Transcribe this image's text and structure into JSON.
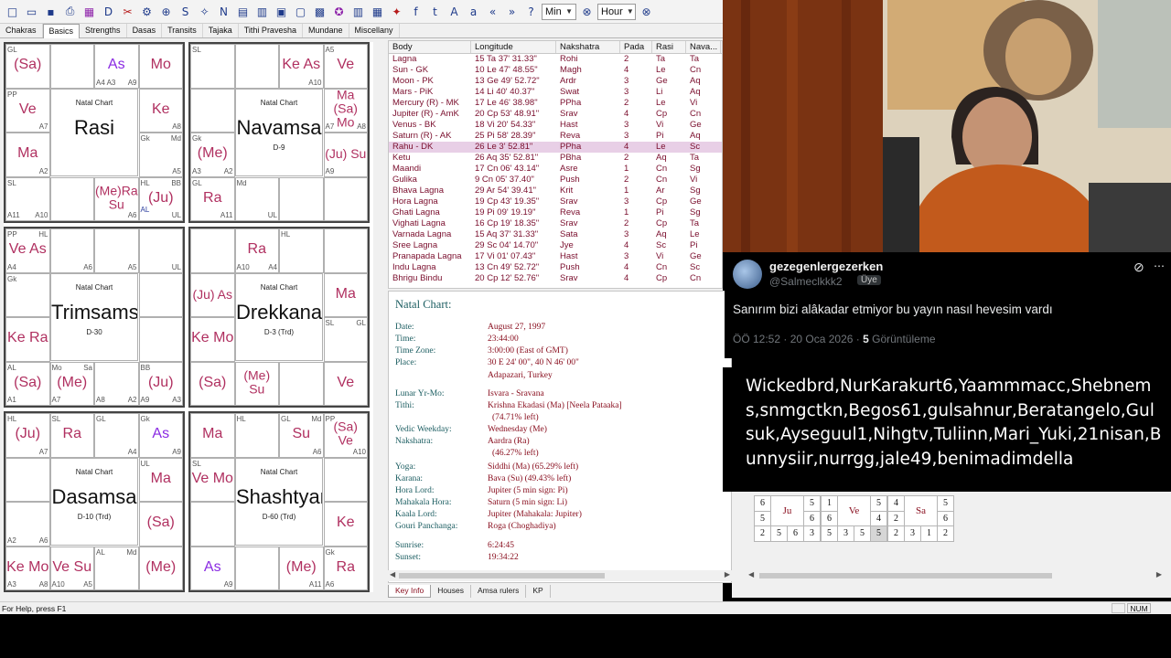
{
  "toolbar": {
    "icons": [
      "new-icon",
      "open-icon",
      "save-icon",
      "print-icon",
      "chart-icon",
      "data-icon",
      "scissors-icon",
      "settings-icon",
      "wheel-icon",
      "sp-kp-icon",
      "bird-icon",
      "n-icon",
      "grid-icon",
      "table-icon",
      "sb-icon",
      "frame-icon",
      "calendar-icon",
      "people-icon",
      "book-icon",
      "gift-icon",
      "bird2-icon",
      "facebook-icon",
      "twitter-icon",
      "text-a-icon",
      "text-a-small-icon",
      "back-icon",
      "forward-icon",
      "help-icon",
      "wheel2-icon"
    ],
    "min_label": "Min",
    "hour_label": "Hour"
  },
  "tabs": [
    "Chakras",
    "Basics",
    "Strengths",
    "Dasas",
    "Transits",
    "Tajaka",
    "Tithi Pravesha",
    "Mundane",
    "Miscellany"
  ],
  "active_tab": "Basics",
  "charts": [
    {
      "title": "Rasi",
      "subtitle": "Natal Chart",
      "note": "",
      "cells": [
        {
          "tl": "GL",
          "tr": "",
          "bl": "",
          "br": "",
          "planets": "(Sa)"
        },
        {
          "tl": "",
          "tr": "",
          "bl": "",
          "br": "",
          "planets": ""
        },
        {
          "tl": "",
          "tr": "",
          "bl": "A4 A3",
          "br": "A9",
          "planets": "As",
          "purple": true
        },
        {
          "tl": "",
          "tr": "",
          "bl": "",
          "br": "",
          "planets": "Mo"
        },
        {
          "tl": "",
          "tr": "",
          "bl": "",
          "br": "A8",
          "planets": "Ke"
        },
        {
          "tl": "Gk",
          "tr": "Md",
          "bl": "",
          "br": "A5",
          "planets": ""
        },
        {
          "tl": "HL",
          "tr": "BB",
          "bl": "",
          "br": "UL",
          "planets": "(Ju)",
          "asc": "AL"
        },
        {
          "tl": "",
          "tr": "",
          "bl": "",
          "br": "A6",
          "planets": "(Me)Ra Su"
        },
        {
          "tl": "",
          "tr": "",
          "bl": "",
          "br": "",
          "planets": ""
        },
        {
          "tl": "SL",
          "tr": "",
          "bl": "A11",
          "br": "A10",
          "planets": ""
        },
        {
          "tl": "",
          "tr": "",
          "bl": "",
          "br": "A2",
          "planets": "Ma"
        },
        {
          "tl": "PP",
          "tr": "",
          "bl": "",
          "br": "A7",
          "planets": "Ve"
        }
      ]
    },
    {
      "title": "Navamsa",
      "subtitle": "Natal Chart",
      "note": "D-9",
      "cells": [
        {
          "tl": "SL",
          "tr": "",
          "bl": "",
          "br": "",
          "planets": ""
        },
        {
          "tl": "",
          "tr": "",
          "bl": "",
          "br": "",
          "planets": ""
        },
        {
          "tl": "",
          "tr": "",
          "bl": "",
          "br": "A10",
          "planets": "Ke As"
        },
        {
          "tl": "A5",
          "tr": "",
          "bl": "",
          "br": "",
          "planets": "Ve"
        },
        {
          "tl": "",
          "tr": "",
          "bl": "A7",
          "br": "A8",
          "planets": "Ma (Sa) Mo"
        },
        {
          "tl": "",
          "tr": "",
          "bl": "A9",
          "br": "",
          "planets": "(Ju) Su"
        },
        {
          "tl": "",
          "tr": "",
          "bl": "",
          "br": "",
          "planets": ""
        },
        {
          "tl": "",
          "tr": "",
          "bl": "",
          "br": "",
          "planets": ""
        },
        {
          "tl": "Md",
          "tr": "",
          "bl": "",
          "br": "UL",
          "planets": ""
        },
        {
          "tl": "GL",
          "tr": "",
          "bl": "",
          "br": "A11",
          "planets": "Ra"
        },
        {
          "tl": "Gk",
          "tr": "",
          "bl": "A3",
          "br": "A2",
          "planets": "(Me)"
        },
        {
          "tl": "",
          "tr": "",
          "bl": "",
          "br": "",
          "planets": ""
        }
      ]
    },
    {
      "title": "Trimsamsa",
      "subtitle": "Natal Chart",
      "note": "D-30",
      "cells": [
        {
          "tl": "PP",
          "tr": "HL",
          "bl": "A4",
          "br": "",
          "planets": "Ve As"
        },
        {
          "tl": "",
          "tr": "",
          "bl": "",
          "br": "A6",
          "planets": ""
        },
        {
          "tl": "",
          "tr": "",
          "bl": "",
          "br": "A5",
          "planets": ""
        },
        {
          "tl": "",
          "tr": "",
          "bl": "",
          "br": "UL",
          "planets": ""
        },
        {
          "tl": "",
          "tr": "",
          "bl": "",
          "br": "",
          "planets": ""
        },
        {
          "tl": "",
          "tr": "",
          "bl": "",
          "br": "",
          "planets": ""
        },
        {
          "tl": "BB",
          "tr": "",
          "bl": "A9",
          "br": "A3",
          "planets": "(Ju)"
        },
        {
          "tl": "",
          "tr": "",
          "bl": "A8",
          "br": "A2",
          "planets": ""
        },
        {
          "tl": "Mo",
          "tr": "Sa",
          "bl": "A7",
          "br": "",
          "planets": "(Me)"
        },
        {
          "tl": "AL",
          "tr": "",
          "bl": "A1",
          "br": "",
          "planets": "(Sa)"
        },
        {
          "tl": "",
          "tr": "",
          "bl": "",
          "br": "",
          "planets": "Ke Ra"
        },
        {
          "tl": "Gk",
          "tr": "",
          "bl": "",
          "br": "",
          "planets": ""
        }
      ]
    },
    {
      "title": "Drekkana",
      "subtitle": "Natal Chart",
      "note": "D-3 (Trd)",
      "cells": [
        {
          "tl": "",
          "tr": "",
          "bl": "",
          "br": "",
          "planets": ""
        },
        {
          "tl": "",
          "tr": "",
          "bl": "A10",
          "br": "A4",
          "planets": "Ra"
        },
        {
          "tl": "HL",
          "tr": "",
          "bl": "",
          "br": "",
          "planets": ""
        },
        {
          "tl": "",
          "tr": "",
          "bl": "",
          "br": "",
          "planets": ""
        },
        {
          "tl": "",
          "tr": "",
          "bl": "",
          "br": "",
          "planets": "Ma"
        },
        {
          "tl": "SL",
          "tr": "GL",
          "bl": "",
          "br": "",
          "planets": ""
        },
        {
          "tl": "",
          "tr": "",
          "bl": "",
          "br": "",
          "planets": "Ve"
        },
        {
          "tl": "",
          "tr": "",
          "bl": "",
          "br": "",
          "planets": ""
        },
        {
          "tl": "",
          "tr": "",
          "bl": "",
          "br": "",
          "planets": "(Me) Su"
        },
        {
          "tl": "",
          "tr": "",
          "bl": "",
          "br": "",
          "planets": "(Sa)"
        },
        {
          "tl": "",
          "tr": "",
          "bl": "",
          "br": "",
          "planets": "Ke Mo"
        },
        {
          "tl": "",
          "tr": "",
          "bl": "",
          "br": "",
          "planets": "(Ju) As"
        }
      ]
    },
    {
      "title": "Dasamsa",
      "subtitle": "Natal Chart",
      "note": "D-10 (Trd)",
      "cells": [
        {
          "tl": "HL",
          "tr": "",
          "bl": "",
          "br": "A7",
          "planets": "(Ju)"
        },
        {
          "tl": "SL",
          "tr": "",
          "bl": "",
          "br": "",
          "planets": "Ra"
        },
        {
          "tl": "GL",
          "tr": "",
          "bl": "",
          "br": "A4",
          "planets": ""
        },
        {
          "tl": "Gk",
          "tr": "",
          "bl": "",
          "br": "A9",
          "planets": "As",
          "purple": true
        },
        {
          "tl": "UL",
          "tr": "",
          "bl": "",
          "br": "",
          "planets": "Ma"
        },
        {
          "tl": "",
          "tr": "",
          "bl": "",
          "br": "",
          "planets": "(Sa)"
        },
        {
          "tl": "",
          "tr": "",
          "bl": "",
          "br": "",
          "planets": "(Me)"
        },
        {
          "tl": "AL",
          "tr": "Md",
          "bl": "",
          "br": "",
          "planets": ""
        },
        {
          "tl": "",
          "tr": "",
          "bl": "A10",
          "br": "A5",
          "planets": "Ve Su"
        },
        {
          "tl": "",
          "tr": "",
          "bl": "A3",
          "br": "A8",
          "planets": "Ke Mo"
        },
        {
          "tl": "",
          "tr": "",
          "bl": "A2",
          "br": "A6",
          "planets": ""
        },
        {
          "tl": "",
          "tr": "",
          "bl": "",
          "br": "",
          "planets": ""
        }
      ]
    },
    {
      "title": "Shashtyamsa",
      "subtitle": "Natal Chart",
      "note": "D-60 (Trd)",
      "cells": [
        {
          "tl": "",
          "tr": "",
          "bl": "",
          "br": "",
          "planets": "Ma"
        },
        {
          "tl": "HL",
          "tr": "",
          "bl": "",
          "br": "",
          "planets": ""
        },
        {
          "tl": "GL",
          "tr": "Md",
          "bl": "",
          "br": "A6",
          "planets": "Su"
        },
        {
          "tl": "PP",
          "tr": "",
          "bl": "",
          "br": "A10",
          "planets": "(Sa) Ve"
        },
        {
          "tl": "",
          "tr": "",
          "bl": "",
          "br": "",
          "planets": ""
        },
        {
          "tl": "",
          "tr": "",
          "bl": "",
          "br": "",
          "planets": "Ke"
        },
        {
          "tl": "Gk",
          "tr": "",
          "bl": "A6",
          "br": "",
          "planets": "Ra"
        },
        {
          "tl": "",
          "tr": "",
          "bl": "",
          "br": "A11",
          "planets": "(Me)"
        },
        {
          "tl": "",
          "tr": "",
          "bl": "",
          "br": "",
          "planets": ""
        },
        {
          "tl": "",
          "tr": "",
          "bl": "",
          "br": "A9",
          "planets": "As",
          "purple": true
        },
        {
          "tl": "",
          "tr": "",
          "bl": "",
          "br": "",
          "planets": ""
        },
        {
          "tl": "SL",
          "tr": "",
          "bl": "",
          "br": "",
          "planets": "Ve Mo"
        }
      ]
    }
  ],
  "bodies": {
    "headers": [
      "Body",
      "Longitude",
      "Nakshatra",
      "Pada",
      "Rasi",
      "Nava..."
    ],
    "rows": [
      [
        "Lagna",
        "15 Ta 37' 31.33\"",
        "Rohi",
        "2",
        "Ta",
        "Ta"
      ],
      [
        "Sun - GK",
        "10 Le 47' 48.55\"",
        "Magh",
        "4",
        "Le",
        "Cn"
      ],
      [
        "Moon - PK",
        "13 Ge 49' 52.72\"",
        "Ardr",
        "3",
        "Ge",
        "Aq"
      ],
      [
        "Mars - PiK",
        "14 Li 40' 40.37\"",
        "Swat",
        "3",
        "Li",
        "Aq"
      ],
      [
        "Mercury (R) - MK",
        "17 Le 46' 38.98\"",
        "PPha",
        "2",
        "Le",
        "Vi"
      ],
      [
        "Jupiter (R) - AmK",
        "20 Cp 53' 48.91\"",
        "Srav",
        "4",
        "Cp",
        "Cn"
      ],
      [
        "Venus - BK",
        "18 Vi 20' 54.33\"",
        "Hast",
        "3",
        "Vi",
        "Ge"
      ],
      [
        "Saturn (R) - AK",
        "25 Pi 58' 28.39\"",
        "Reva",
        "3",
        "Pi",
        "Aq"
      ],
      [
        "Rahu - DK",
        "26 Le 3' 52.81\"",
        "PPha",
        "4",
        "Le",
        "Sc"
      ],
      [
        "Ketu",
        "26 Aq 35' 52.81\"",
        "PBha",
        "2",
        "Aq",
        "Ta"
      ],
      [
        "Maandi",
        "17 Cn 06' 43.14\"",
        "Asre",
        "1",
        "Cn",
        "Sg"
      ],
      [
        "Gulika",
        "9 Cn 05' 37.40\"",
        "Push",
        "2",
        "Cn",
        "Vi"
      ],
      [
        "Bhava Lagna",
        "29 Ar 54' 39.41\"",
        "Krit",
        "1",
        "Ar",
        "Sg"
      ],
      [
        "Hora Lagna",
        "19 Cp 43' 19.35\"",
        "Srav",
        "3",
        "Cp",
        "Ge"
      ],
      [
        "Ghati Lagna",
        "19 Pi 09' 19.19\"",
        "Reva",
        "1",
        "Pi",
        "Sg"
      ],
      [
        "Vighati Lagna",
        "16 Cp 19' 18.35\"",
        "Srav",
        "2",
        "Cp",
        "Ta"
      ],
      [
        "Varnada Lagna",
        "15 Aq 37' 31.33\"",
        "Sata",
        "3",
        "Aq",
        "Le"
      ],
      [
        "Sree Lagna",
        "29 Sc 04' 14.70\"",
        "Jye",
        "4",
        "Sc",
        "Pi"
      ],
      [
        "Pranapada Lagna",
        "17 Vi 01' 07.43\"",
        "Hast",
        "3",
        "Vi",
        "Ge"
      ],
      [
        "Indu Lagna",
        "13 Cn 49' 52.72\"",
        "Push",
        "4",
        "Cn",
        "Sc"
      ],
      [
        "Bhrigu Bindu",
        "20 Cp 12' 52.76\"",
        "Srav",
        "4",
        "Cp",
        "Cn"
      ]
    ],
    "selected_index": 8
  },
  "keyinfo": {
    "title": "Natal Chart:",
    "rows": [
      [
        "Date:",
        "August 27, 1997"
      ],
      [
        "Time:",
        "23:44:00"
      ],
      [
        "Time Zone:",
        "3:00:00 (East of GMT)"
      ],
      [
        "Place:",
        "30 E 24' 00\", 40 N 46' 00\""
      ],
      [
        "",
        "Adapazari, Turkey"
      ],
      [
        "Lunar Yr-Mo:",
        "Isvara - Sravana"
      ],
      [
        "Tithi:",
        "Krishna Ekadasi (Ma) [Neela Pataaka]"
      ],
      [
        "",
        "(74.71% left)"
      ],
      [
        "Vedic Weekday:",
        "Wednesday (Me)"
      ],
      [
        "Nakshatra:",
        "Aardra (Ra)"
      ],
      [
        "",
        "(46.27% left)"
      ],
      [
        "Yoga:",
        "Siddhi (Ma) (65.29% left)"
      ],
      [
        "Karana:",
        "Bava (Su) (49.43% left)"
      ],
      [
        "Hora Lord:",
        "Jupiter (5 min sign: Pi)"
      ],
      [
        "Mahakala Hora:",
        "Saturn (5 min sign: Li)"
      ],
      [
        "Kaala Lord:",
        "Jupiter (Mahakala: Jupiter)"
      ],
      [
        "Gouri Panchanga:",
        "Roga (Choghadiya)"
      ],
      [
        "Sunrise:",
        "6:24:45"
      ],
      [
        "Sunset:",
        "19:34:22"
      ]
    ]
  },
  "bottom_tabs": [
    "Key Info",
    "Houses",
    "Amsa rulers",
    "KP"
  ],
  "active_bottom_tab": "Key Info",
  "small_grids": [
    {
      "label": "Ju",
      "top": [
        "6",
        "",
        "5"
      ],
      "mid_l": "5",
      "mid_r": "6",
      "bottom": [
        "2",
        "5",
        "6",
        "3"
      ]
    },
    {
      "label": "Ve",
      "top": [
        "1",
        "",
        "5"
      ],
      "mid_l": "6",
      "mid_r": "4",
      "bottom": [
        "5",
        "3",
        "5",
        "5"
      ]
    },
    {
      "label": "Sa",
      "top": [
        "4",
        "",
        "5"
      ],
      "mid_l": "2",
      "mid_r": "6",
      "bottom": [
        "2",
        "3",
        "1",
        "2"
      ]
    }
  ],
  "status": {
    "help": "For Help, press F1",
    "num": "NUM"
  },
  "tweet": {
    "name": "gezegenlergezerken",
    "handle": "@Salmeclkkk2",
    "badge": "Üye",
    "text": "Sanırım bizi alâkadar etmiyor bu yayın nasıl hevesim vardı",
    "time": "ÖÖ 12:52 · 20 Oca 2026 ·",
    "views_count": "5",
    "views_label": "Görüntüleme"
  },
  "names_overlay": "Wickedbrd,NurKarakurt6,Yaammmacc,Shebnems,snmgctkn,Begos61,gulsahnur,Beratangelo,Gulsuk,Ayseguul1,Nihgtv,Tuliinn,Mari_Yuki,21nisan,Bunnysiir,nurrgg,jale49,benimadimdella",
  "colors": {
    "planet": "#b03060",
    "ascendant": "#8a2be2",
    "table_text": "#7a0e2d",
    "key_label": "#1a5c60",
    "key_value": "#8a1020",
    "selected_row": "#e8cfe6"
  }
}
